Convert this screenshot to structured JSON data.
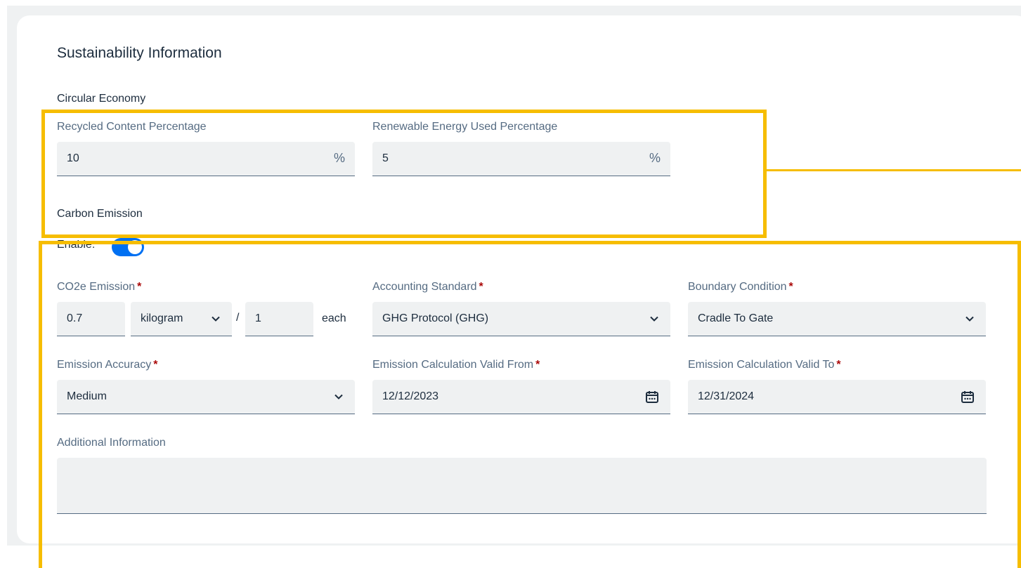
{
  "section": {
    "title": "Sustainability Information"
  },
  "circular_economy": {
    "title": "Circular Economy",
    "recycled": {
      "label": "Recycled Content Percentage",
      "value": "10",
      "unit": "%"
    },
    "renewable": {
      "label": "Renewable Energy Used Percentage",
      "value": "5",
      "unit": "%"
    }
  },
  "carbon_emission": {
    "title": "Carbon Emission",
    "enable_label": "Enable:",
    "enabled": true,
    "co2e": {
      "label": "CO2e Emission",
      "value": "0.7",
      "unit": "kilogram",
      "separator": "/",
      "per_quantity": "1",
      "per_unit": "each"
    },
    "accounting_standard": {
      "label": "Accounting Standard",
      "value": "GHG Protocol (GHG)"
    },
    "boundary_condition": {
      "label": "Boundary Condition",
      "value": "Cradle To Gate"
    },
    "emission_accuracy": {
      "label": "Emission Accuracy",
      "value": "Medium"
    },
    "valid_from": {
      "label": "Emission Calculation Valid From",
      "value": "12/12/2023"
    },
    "valid_to": {
      "label": "Emission Calculation Valid To",
      "value": "12/31/2024"
    },
    "additional_info": {
      "label": "Additional Information",
      "value": ""
    },
    "required_marker": "*"
  },
  "colors": {
    "highlight": "#f6bd00",
    "toggle_on": "#0070f2",
    "required": "#aa0808",
    "field_bg": "#eff1f2"
  }
}
